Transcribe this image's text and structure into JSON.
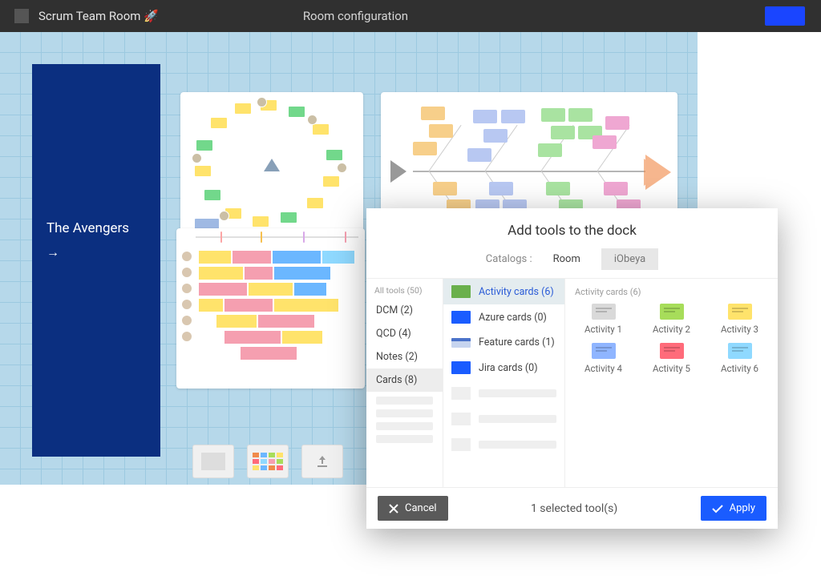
{
  "header": {
    "room_title": "Scrum Team Room 🚀",
    "config_label": "Room configuration"
  },
  "side_card": {
    "title": "The Avengers",
    "arrow": "→"
  },
  "dock": {
    "items": [
      "template-blank",
      "template-cards",
      "template-upload"
    ]
  },
  "dialog": {
    "title": "Add tools to the dock",
    "catalogs_label": "Catalogs :",
    "catalog_tabs": [
      "Room",
      "iObeya"
    ],
    "categories_header": "All tools (50)",
    "categories": [
      {
        "label": "DCM (2)"
      },
      {
        "label": "QCD (4)"
      },
      {
        "label": "Notes (2)"
      },
      {
        "label": "Cards (8)",
        "active": true
      }
    ],
    "tools": [
      {
        "label": "Activity cards (6)",
        "color": "#6ab04c",
        "selected": true
      },
      {
        "label": "Azure cards (0)",
        "color": "#1a5cff"
      },
      {
        "label": "Feature cards (1)",
        "color": "#9fb9e3"
      },
      {
        "label": "Jira cards (0)",
        "color": "#1a5cff"
      }
    ],
    "preview_header": "Activity cards (6)",
    "activities": [
      {
        "label": "Activity 1",
        "color": "#d9d9d9"
      },
      {
        "label": "Activity 2",
        "color": "#a7dd5a"
      },
      {
        "label": "Activity 3",
        "color": "#ffe36b"
      },
      {
        "label": "Activity 4",
        "color": "#8fb5ff"
      },
      {
        "label": "Activity 5",
        "color": "#ff6b7a"
      },
      {
        "label": "Activity 6",
        "color": "#8fd9ff"
      }
    ],
    "footer": {
      "cancel": "Cancel",
      "status": "1 selected tool(s)",
      "apply": "Apply"
    }
  }
}
